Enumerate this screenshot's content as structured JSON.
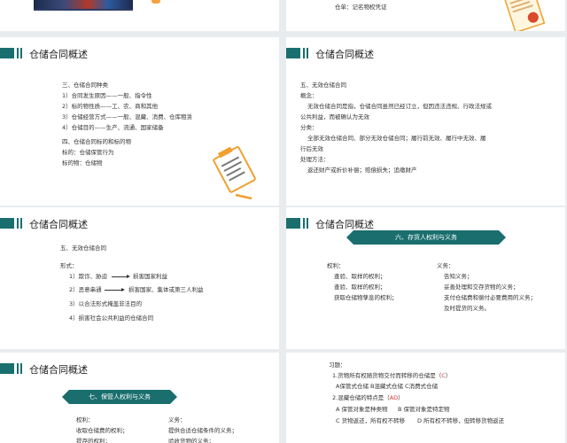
{
  "colors": {
    "accent": "#1a6e6e",
    "answer": "#d33333"
  },
  "top_right": {
    "line": "仓单：记名物权凭证"
  },
  "slide1": {
    "title": "仓储合同概述",
    "lines": [
      "三、仓储合同种类",
      "1）合同发生原因——一般、指令性",
      "2）标的物性质——工、农、商和其他",
      "3）仓储经营方式——一般、混藏、消费、仓库租赁",
      "4）仓储目的——生产、流通、国家储备",
      "四、仓储合同标的和标的物",
      "标的：仓储保管行为",
      "标的物：仓储物"
    ]
  },
  "slide2": {
    "title": "仓储合同概述",
    "lines": [
      "五、无效仓储合同",
      "概念：",
      "无效仓储合同是指，仓储合同虽然已经订立，但因违法违规、行政法规或",
      "公共利益，而被确认为无效",
      "分类：",
      "全部无效仓储合同、部分无效仓储合同；履行前无效、履行中无效、履",
      "行后无效",
      "处理方法：",
      "返还财产或折价补偿；赔偿损失；追缴财产"
    ]
  },
  "slide3": {
    "title": "仓储合同概述",
    "heading": "五、无效仓储合同",
    "form_label": "形式：",
    "items": [
      {
        "text": "1）欺诈、胁迫",
        "result": "损害国家利益"
      },
      {
        "text": "2）恶意串通",
        "result": "损害国家、集体或第三人利益"
      },
      {
        "text": "3）以合法形式掩盖非法目的",
        "result": ""
      },
      {
        "text": "4）损害社会公共利益的仓储合同",
        "result": ""
      }
    ]
  },
  "slide4": {
    "title": "仓储合同概述",
    "banner": "六、存货人权利与义务",
    "rights_label": "权利：",
    "rights": [
      "查验、取样的权利；",
      "查验、取样的权利；",
      "获取仓储物孳息的权利；"
    ],
    "duties_label": "义务：",
    "duties": [
      "告知义务；",
      "妥善处理和交存货物的义务；",
      "支付仓储费和偿付必要费用的义务；",
      "及时提货的义务。"
    ]
  },
  "slide5": {
    "title": "仓储合同概述",
    "banner": "七、保管人权利与义务",
    "rights_label": "权利：",
    "rights": [
      "收取仓储费的权利；",
      "提存的权利；"
    ],
    "duties_label": "义务：",
    "duties": [
      "提供合适仓储条件的义务；",
      "验收货物的义务；"
    ]
  },
  "slide6": {
    "heading": "习题：",
    "q1": "1.货物所有权随货物交付而转移的仓储是（",
    "q1_ans": "C",
    "q1_end": "）",
    "q1_opts": "A保管式仓储 B混藏式仓储 C消费式仓储",
    "q2": "2.混藏仓储的特点是（",
    "q2_ans": "AD",
    "q2_end": "）",
    "q2_opts_a": "A 保管对象是种类物",
    "q2_opts_b": "B 保管对象是特定物",
    "q2_opts_c": "C 货物返还，所有权不转移",
    "q2_opts_d": "D 所有权不转移，但转移货物返还"
  }
}
